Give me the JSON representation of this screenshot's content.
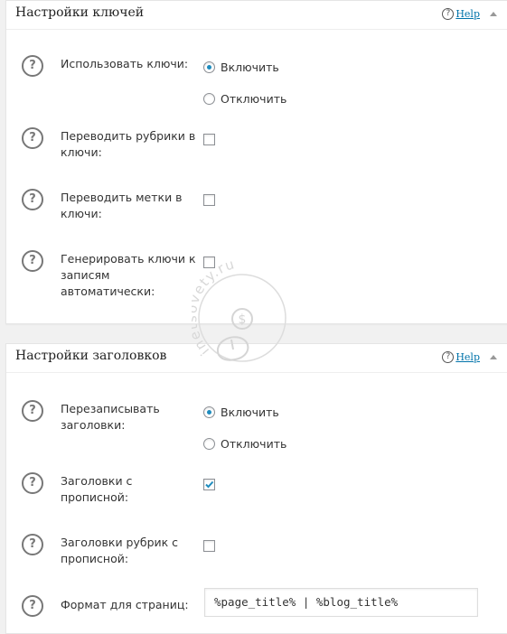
{
  "keys_panel": {
    "title": "Настройки ключей",
    "help_label": "Help",
    "use_keys_label": "Использовать ключи:",
    "use_keys_options": [
      "Включить",
      "Отключить"
    ],
    "use_keys_selected": "Включить",
    "categories_label": "Переводить рубрики в ключи:",
    "categories_checked": false,
    "tags_label": "Переводить метки в ключи:",
    "tags_checked": false,
    "autogen_label": "Генерировать ключи к записям автоматически:",
    "autogen_checked": false
  },
  "titles_panel": {
    "title": "Настройки заголовков",
    "help_label": "Help",
    "rewrite_label": "Перезаписывать заголовки:",
    "rewrite_options": [
      "Включить",
      "Отключить"
    ],
    "rewrite_selected": "Включить",
    "capitalize_label": "Заголовки с прописной:",
    "capitalize_checked": true,
    "cat_capitalize_label": "Заголовки рубрик с прописной:",
    "cat_capitalize_checked": false,
    "page_format_label": "Формат для страниц:",
    "page_format_value": "%page_title% | %blog_title%"
  },
  "watermark": {
    "text": "inetsovety.ru"
  },
  "colors": {
    "accent": "#1e8cbe",
    "check": "#1e8cbe",
    "link": "#0073aa"
  },
  "icons": [
    "help-circle-icon",
    "collapse-arrow-icon",
    "watermark-mouse-icon"
  ]
}
